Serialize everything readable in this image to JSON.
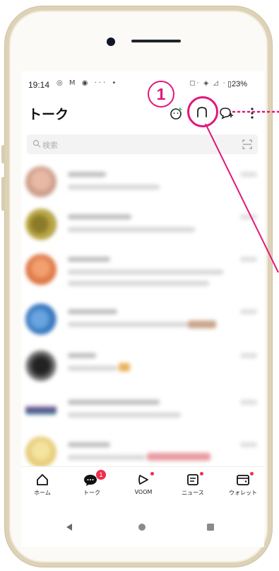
{
  "status_bar": {
    "time": "19:14",
    "left_icons": "◎ M ◉ ··· •",
    "right_icons": "▢· ◈ ◿ ·",
    "battery": "▯23%"
  },
  "header": {
    "title": "トーク"
  },
  "search": {
    "placeholder": "検索"
  },
  "tabs": [
    {
      "label": "ホーム",
      "icon": "home-icon",
      "has_dot": false
    },
    {
      "label": "トーク",
      "icon": "chat-icon",
      "badge": "1"
    },
    {
      "label": "VOOM",
      "icon": "voom-icon",
      "has_dot": true
    },
    {
      "label": "ニュース",
      "icon": "news-icon",
      "has_dot": true
    },
    {
      "label": "ウォレット",
      "icon": "wallet-icon",
      "has_dot": true
    }
  ],
  "annotation": {
    "step_number": "1",
    "color": "#e2177c"
  },
  "colors": {
    "accent_red": "#ef2e4c",
    "frame_gold": "#ddd2b8"
  }
}
